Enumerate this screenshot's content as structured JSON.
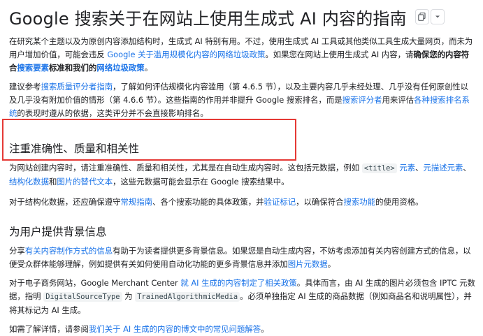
{
  "page": {
    "title": "Google 搜索关于在网站上使用生成式 AI 内容的指南",
    "actions": {
      "copy_icon": "copy-icon",
      "menu_icon": "chevron-down-icon"
    }
  },
  "p1": {
    "t1": "在研究某个主题以及为原创内容添加结构时，生成式 AI 特别有用。不过，使用生成式 AI 工具或其他类似工具生成大量网页，而未为用户增加价值，可能会违反 ",
    "link1": "Google 关于滥用规模化内容的网络垃圾政策",
    "t2": "。如果您在网站上使用生成式 AI 内容，请",
    "bold1": "确保您的内容符合",
    "link2": "搜索要素",
    "bold2": "标准和我们的",
    "link3": "网络垃圾政策",
    "t3": "。"
  },
  "p2": {
    "t1": "建议参考",
    "link1": "搜索质量评分者指南",
    "t2": "，了解如何评估规模化内容滥用（第 4.6.5 节），以及主要内容几乎未经处理、几乎没有任何原创性以及几乎没有附加价值的情形（第 4.6.6 节）。这些指南的作用并非提升 Google 搜索排名，而是",
    "link2": "搜索评分者",
    "t3": "用来评估",
    "link3": "各种搜索排名系统",
    "t4": "的表现时遵从的依据，这类评分并不会直接影响排名。"
  },
  "section1": {
    "heading": "注重准确性、质量和相关性",
    "t1": "为网站创建内容时，请注重准确性、质量和相关性，尤其是在自动生成内容时。这包括元数据，例如 ",
    "code1": "<title>",
    "t2": " ",
    "link1": "元素",
    "t3": "、",
    "link2": "元描述元素",
    "t4": "、",
    "link3": "结构化数据",
    "t5": "和",
    "link4": "图片的替代文本",
    "t6": "，这些元数据可能会显示在 Google 搜索结果中。"
  },
  "p4": {
    "t1": "对于结构化数据，还应确保遵守",
    "link1": "常规指南",
    "t2": "、各个搜索功能的具体政策，并",
    "link2": "验证标记",
    "t3": "，以确保符合",
    "link3": "搜索功能",
    "t4": "的使用资格。"
  },
  "section2": {
    "heading": "为用户提供背景信息",
    "t1": "分享",
    "link1": "有关内容制作方式的信息",
    "t2": "有助于为读者提供更多背景信息。如果您是自动生成内容，不妨考虑添加有关内容创建方式的信息，以便受众群体能够理解，例如提供有关如何使用自动化功能的更多背景信息并添加",
    "link2": "图片元数据",
    "t3": "。"
  },
  "p6": {
    "t1": "对于电子商务网站，Google Merchant Center ",
    "link1": "就 AI 生成的内容制定了相关政策",
    "t2": "。具体而言，由 AI 生成的图片必须包含 IPTC 元数据，指明 ",
    "code1": "DigitalSourceType",
    "t3": " 为 ",
    "code2": "TrainedAlgorithmicMedia",
    "t4": "。必须单独指定 AI 生成的商品数据（例如商品名和说明属性），并将其标记为 AI 生成。"
  },
  "p7": {
    "t1": "如需了解详情，请参阅",
    "link1": "我们关于 AI 生成的内容的博文中的常见问题解答",
    "t2": "。"
  },
  "colors": {
    "link": "#1a73e8",
    "highlight": "#e53935",
    "text": "#202124"
  }
}
